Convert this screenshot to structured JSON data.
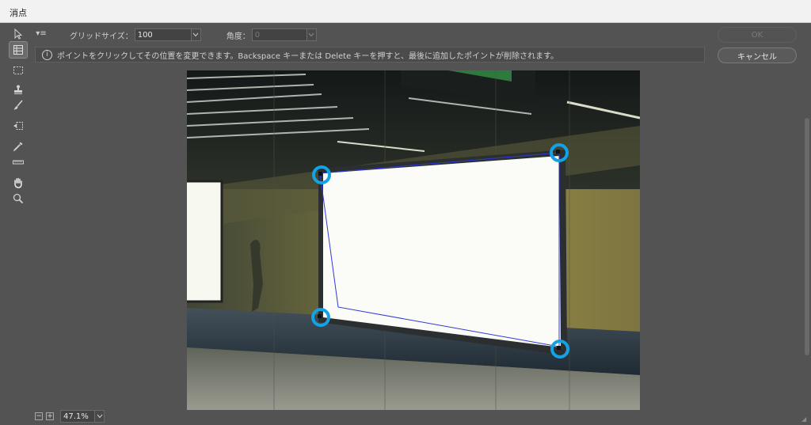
{
  "window": {
    "title": "消点"
  },
  "options": {
    "grid_size_label": "グリッドサイズ：",
    "grid_size_value": "100",
    "angle_label": "角度：",
    "angle_value": "0"
  },
  "buttons": {
    "ok": "OK",
    "cancel": "キャンセル"
  },
  "info": {
    "text": "ポイントをクリックしてその位置を変更できます。Backspace キーまたは Delete キーを押すと、最後に追加したポイントが削除されます。"
  },
  "status": {
    "zoom": "47.1%",
    "zoom_out": "−",
    "zoom_in": "+"
  },
  "tools": [
    {
      "name": "edit-plane-tool-icon"
    },
    {
      "name": "create-plane-tool-icon"
    },
    {
      "name": "marquee-tool-icon"
    },
    {
      "name": "stamp-tool-icon"
    },
    {
      "name": "brush-tool-icon"
    },
    {
      "name": "transform-tool-icon"
    },
    {
      "name": "eyedropper-tool-icon"
    },
    {
      "name": "measure-tool-icon"
    },
    {
      "name": "hand-tool-icon"
    },
    {
      "name": "zoom-tool-icon"
    }
  ],
  "colors": {
    "handle": "#12a2e6",
    "plane_line": "#2f3bd6",
    "panel": "#535353"
  }
}
